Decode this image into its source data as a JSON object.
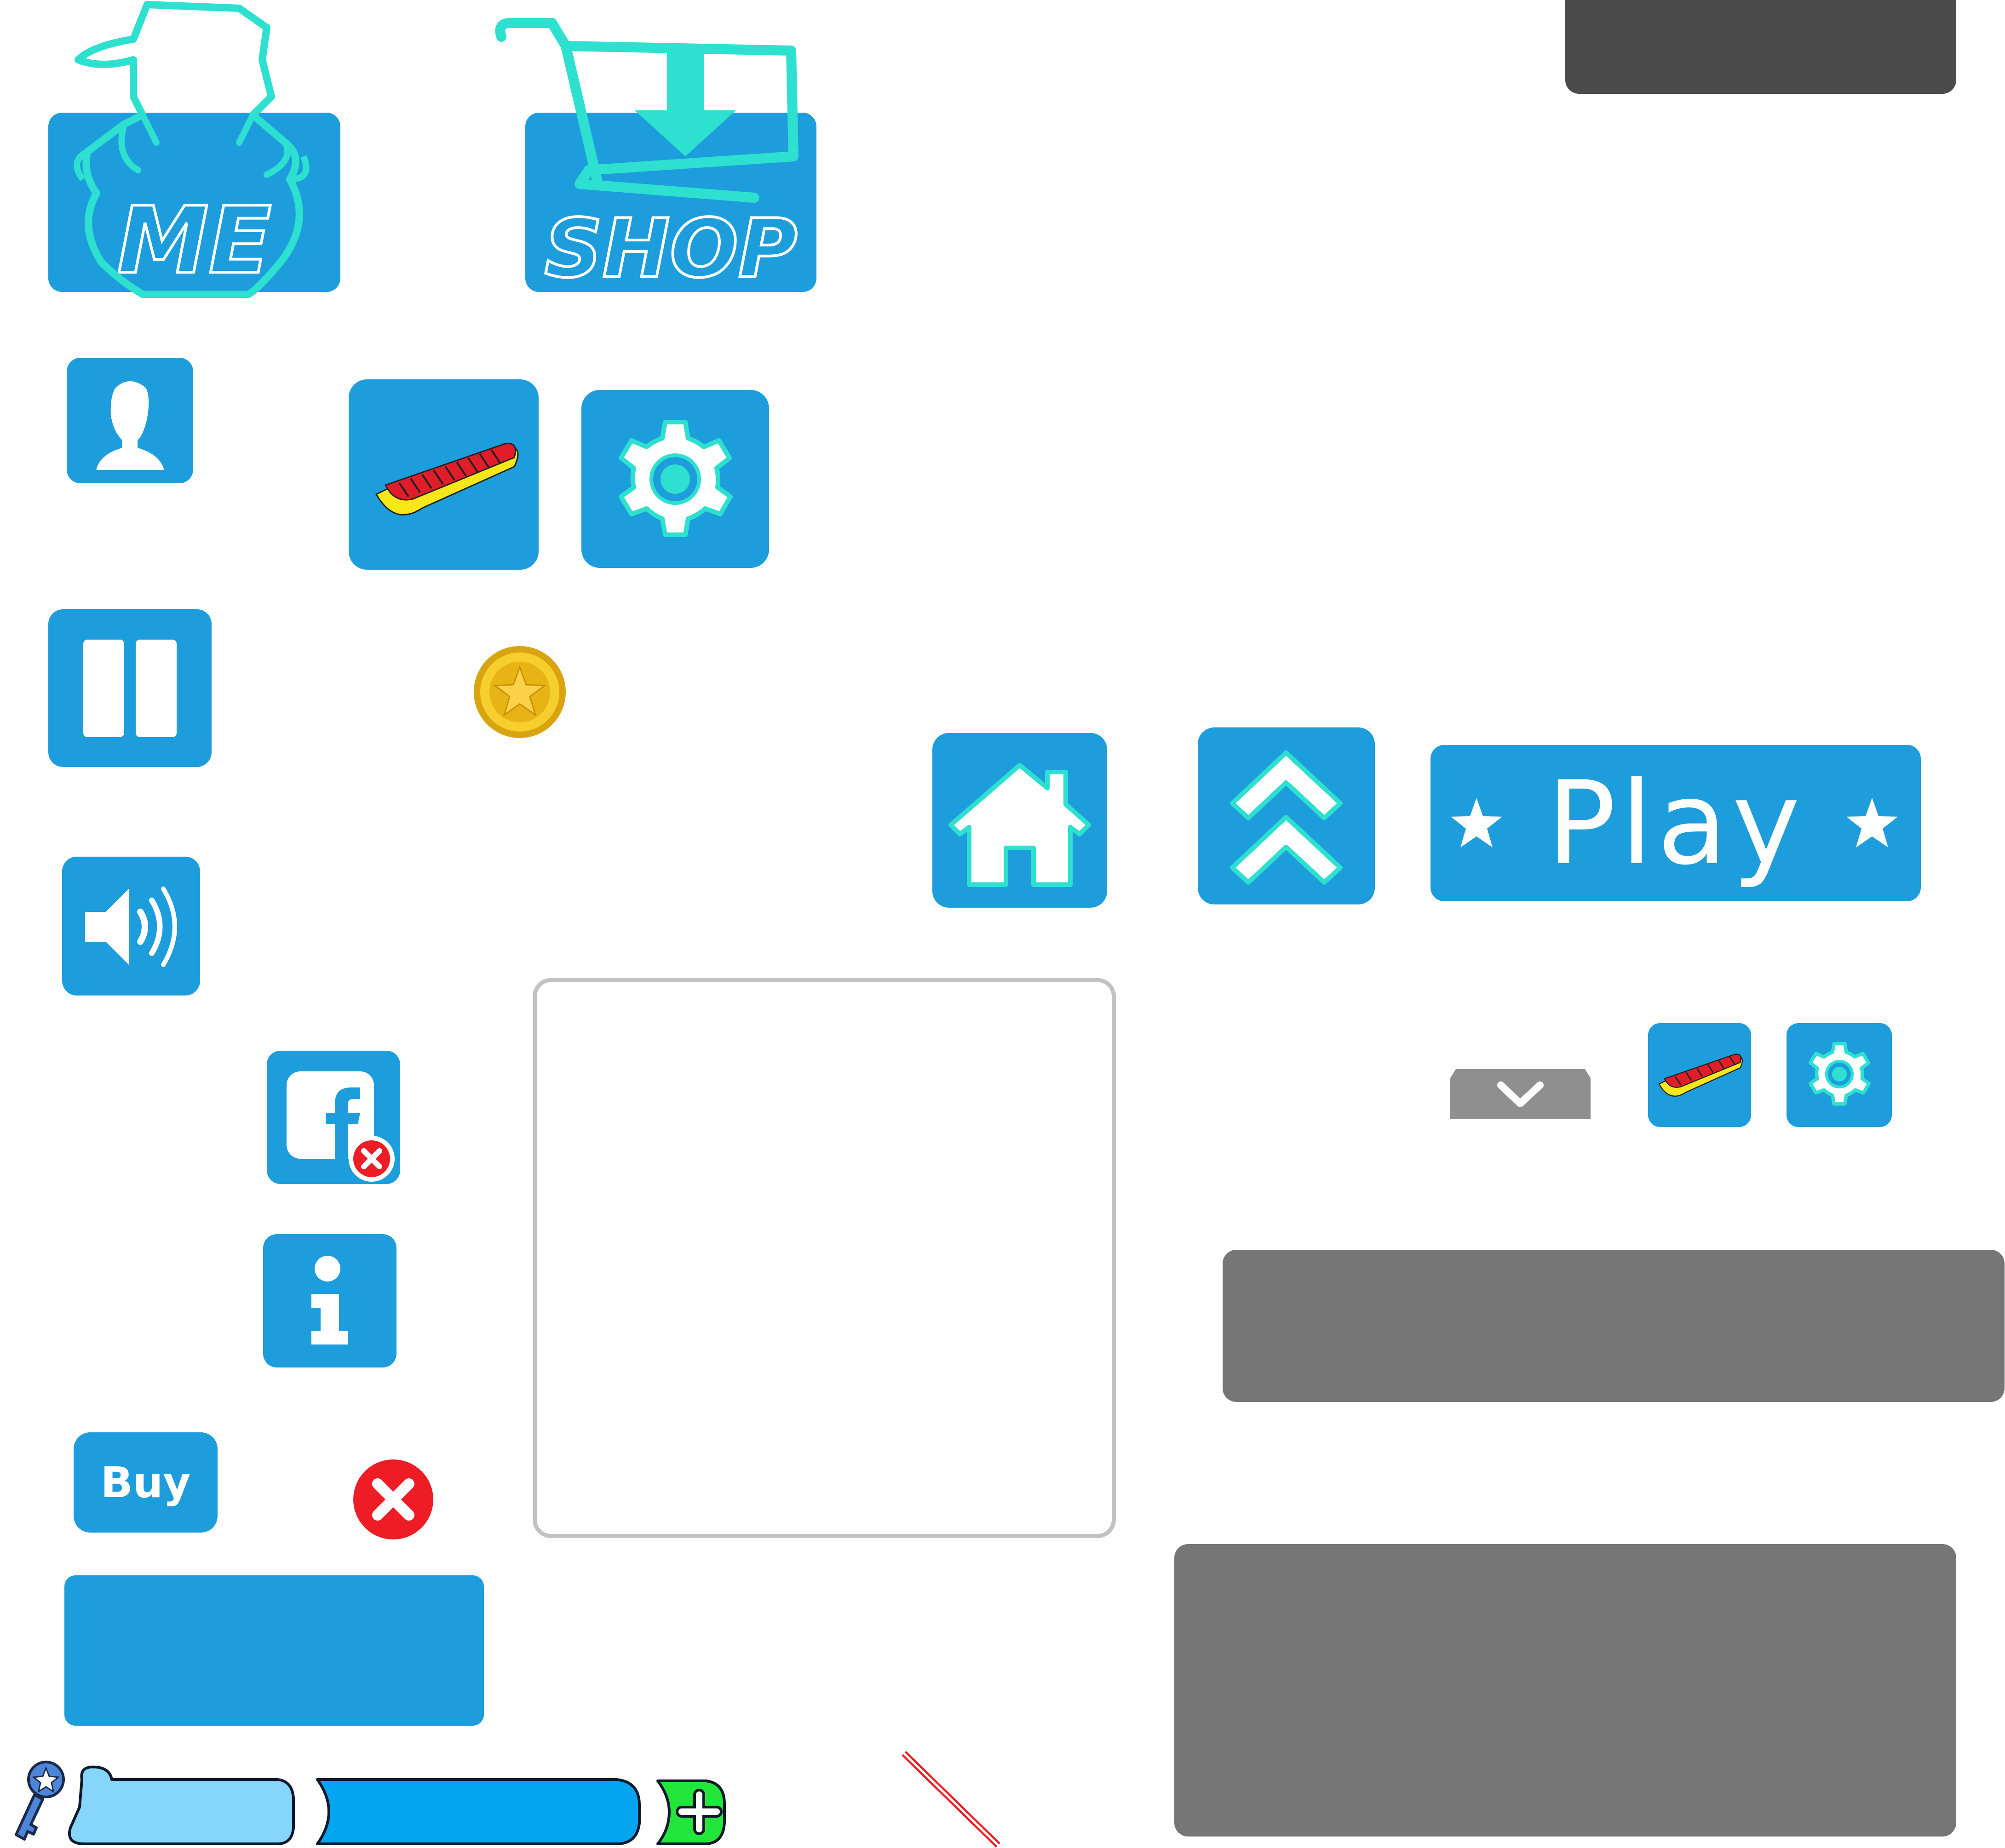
{
  "colors": {
    "button_blue": "#1e9ddc",
    "accent_teal": "#2de0cf",
    "panel_dark": "#4b4b4b",
    "panel_gray": "#767676",
    "light_gray": "#8f8f8f",
    "frame_border": "#c2c2c2",
    "close_red": "#ee1c25",
    "bar_light": "#86d5fb",
    "bar_fill": "#03a5f0",
    "plus_green": "#22e63c",
    "coin_gold": "#f1c21b"
  },
  "menu": {
    "me_label": "ME",
    "shop_label": "SHOP"
  },
  "buttons": {
    "buy_label": "Buy",
    "play_label": "Play"
  },
  "icons": [
    "me-character-icon",
    "shop-cart-icon",
    "profile-icon",
    "skateboard-icon",
    "settings-gear-icon",
    "pause-icon",
    "coin-star-icon",
    "home-icon",
    "double-chevron-up-icon",
    "star-icon",
    "sound-icon",
    "facebook-logout-icon",
    "info-icon",
    "close-icon",
    "chevron-down-icon",
    "key-icon",
    "plus-icon"
  ]
}
